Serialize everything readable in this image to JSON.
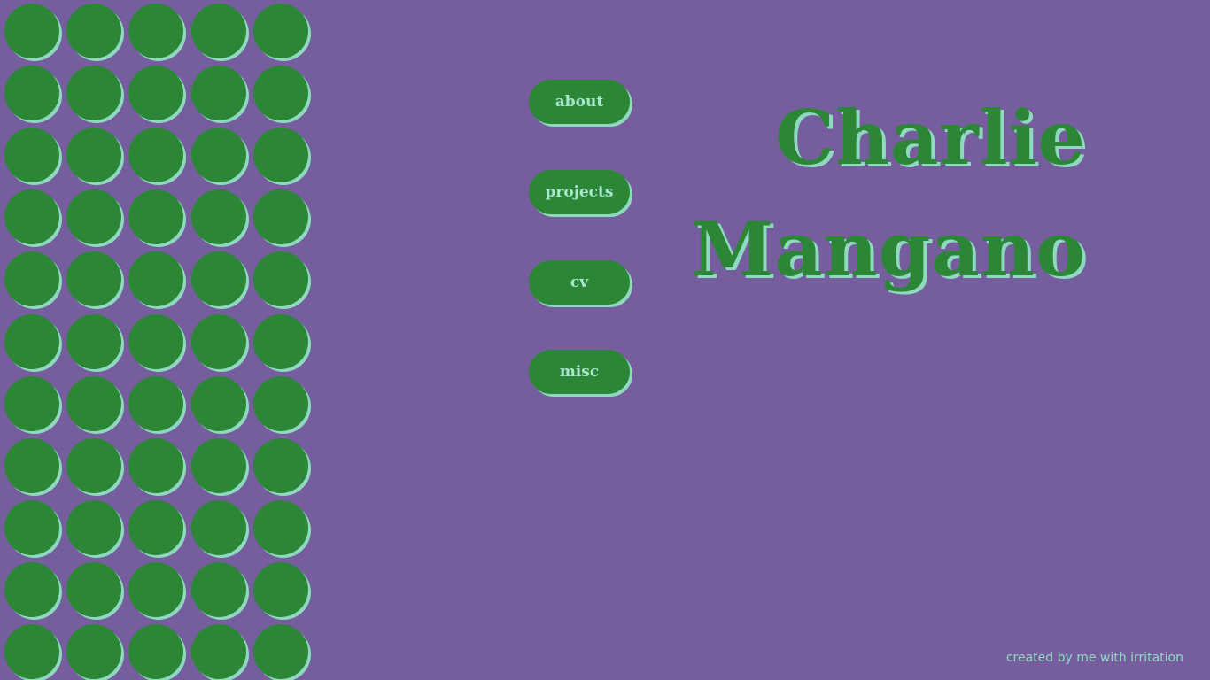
{
  "nav": {
    "about": "about",
    "projects": "projects",
    "cv": "cv",
    "misc": "misc"
  },
  "hero": {
    "first_name": "Charlie",
    "last_name": "Mangano"
  },
  "footer": {
    "note": "created by me with irritation"
  },
  "theme": {
    "background": "#765d9e",
    "primary_green": "#2b8735",
    "mint_shadow": "#8ed9c0"
  },
  "decor": {
    "dot_columns": 5,
    "dot_rows": 11
  }
}
